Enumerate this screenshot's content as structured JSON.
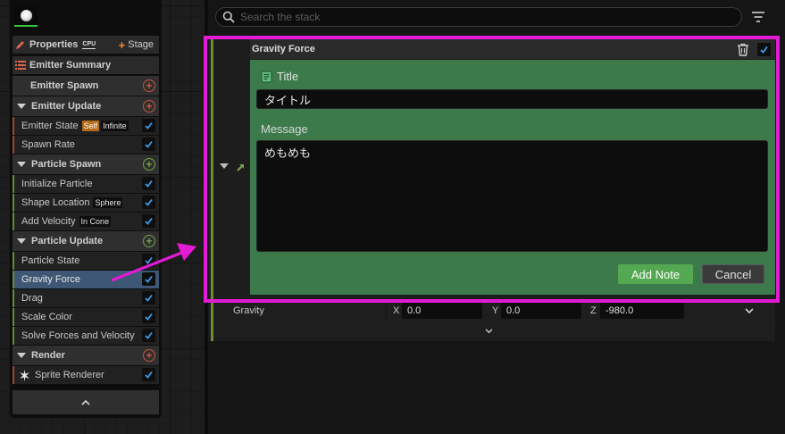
{
  "emitter": {
    "properties_label": "Properties",
    "cpu_badge": "CPU",
    "stage_label": "Stage",
    "summary_label": "Emitter Summary",
    "sections": [
      {
        "title": "Emitter Spawn"
      },
      {
        "title": "Emitter Update",
        "items": [
          {
            "label": "Emitter State",
            "tags": [
              "Self",
              "Infinite"
            ]
          },
          {
            "label": "Spawn Rate"
          }
        ]
      },
      {
        "title": "Particle Spawn",
        "items": [
          {
            "label": "Initialize Particle"
          },
          {
            "label": "Shape Location",
            "tags": [
              "Sphere"
            ]
          },
          {
            "label": "Add Velocity",
            "tags": [
              "In Cone"
            ]
          }
        ]
      },
      {
        "title": "Particle Update",
        "items": [
          {
            "label": "Particle State"
          },
          {
            "label": "Gravity Force",
            "selected": true
          },
          {
            "label": "Drag"
          },
          {
            "label": "Scale Color"
          },
          {
            "label": "Solve Forces and Velocity"
          }
        ]
      },
      {
        "title": "Render",
        "items": [
          {
            "label": "Sprite Renderer"
          }
        ]
      }
    ]
  },
  "search": {
    "placeholder": "Search the stack"
  },
  "stack": {
    "module_title": "Gravity Force",
    "note": {
      "title_label": "Title",
      "title_value": "タイトル",
      "message_label": "Message",
      "message_value": "めもめも",
      "add_button": "Add Note",
      "cancel_button": "Cancel"
    },
    "gravity": {
      "label": "Gravity",
      "x_label": "X",
      "x": "0.0",
      "y_label": "Y",
      "y": "0.0",
      "z_label": "Z",
      "z": "-980.0"
    }
  },
  "colors": {
    "highlight": "#e31ad6",
    "note_bg": "#3c7a4b",
    "selection": "#3e5774",
    "accent_green": "#35c33a"
  }
}
